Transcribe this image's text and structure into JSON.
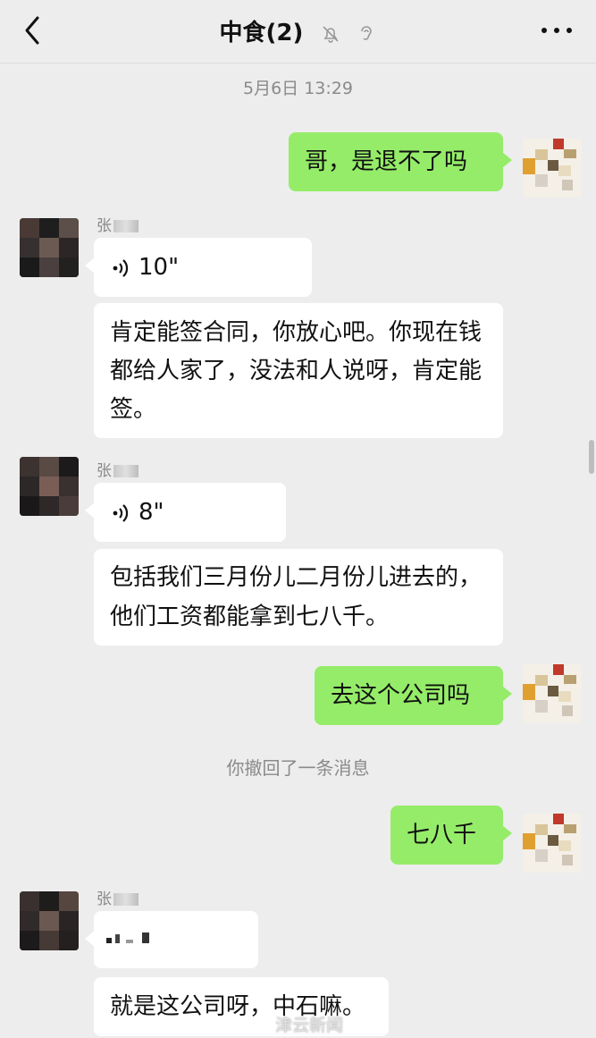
{
  "header": {
    "title": "中食(2)"
  },
  "messages": {
    "timestamp": "5月6日 13:29",
    "m1": "哥，是退不了吗",
    "sender_name": "张",
    "voice1": "10\"",
    "m2": "肯定能签合同，你放心吧。你现在钱都给人家了，没法和人说呀，肯定能签。",
    "voice2": "8\"",
    "m3": "包括我们三月份儿二月份儿进去的，他们工资都能拿到七八千。",
    "m4": "去这个公司吗",
    "recall": "你撤回了一条消息",
    "m5": "七八千",
    "m6": "就是这公司呀，中石嘛。"
  },
  "watermark": "津云新闻",
  "colors": {
    "background": "#ededed",
    "green_bubble": "#95ec69",
    "white_bubble": "#ffffff"
  }
}
